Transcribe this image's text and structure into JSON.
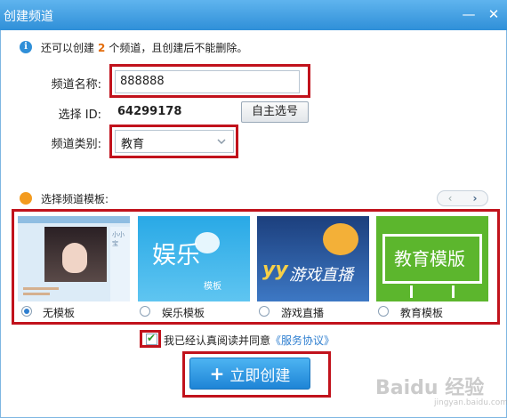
{
  "window": {
    "title": "创建频道",
    "minimize": "—",
    "close": "✕"
  },
  "info": {
    "prefix": "还可以创建",
    "count": "2",
    "suffix": "个频道，且创建后不能删除。"
  },
  "form": {
    "name_label": "频道名称:",
    "name_value": "888888",
    "id_label": "选择 ID:",
    "id_value": "64299178",
    "pick_button": "自主选号",
    "category_label": "频道类别:",
    "category_value": "教育"
  },
  "templates": {
    "label": "选择频道模板:",
    "pager_prev": "‹",
    "pager_next": "›",
    "items": [
      {
        "name": "无模板",
        "selected": true,
        "preview_text": "小小宝"
      },
      {
        "name": "娱乐模板",
        "selected": false,
        "preview_text": "娱乐",
        "preview_sub": "模板"
      },
      {
        "name": "游戏直播",
        "selected": false,
        "preview_text": "游戏直播",
        "preview_logo": "yy"
      },
      {
        "name": "教育模板",
        "selected": false,
        "preview_text": "教育模版"
      }
    ]
  },
  "agreement": {
    "text": "我已经认真阅读并同意",
    "link": "《服务协议》",
    "checked": true
  },
  "create_button": "立即创建",
  "watermark": {
    "main": "Baidu 经验",
    "sub": "jingyan.baidu.com"
  },
  "colors": {
    "title_bar": "#2f8fd8",
    "highlight": "#c1121c",
    "accent": "#e36c0a",
    "button": "#1e84d6"
  }
}
